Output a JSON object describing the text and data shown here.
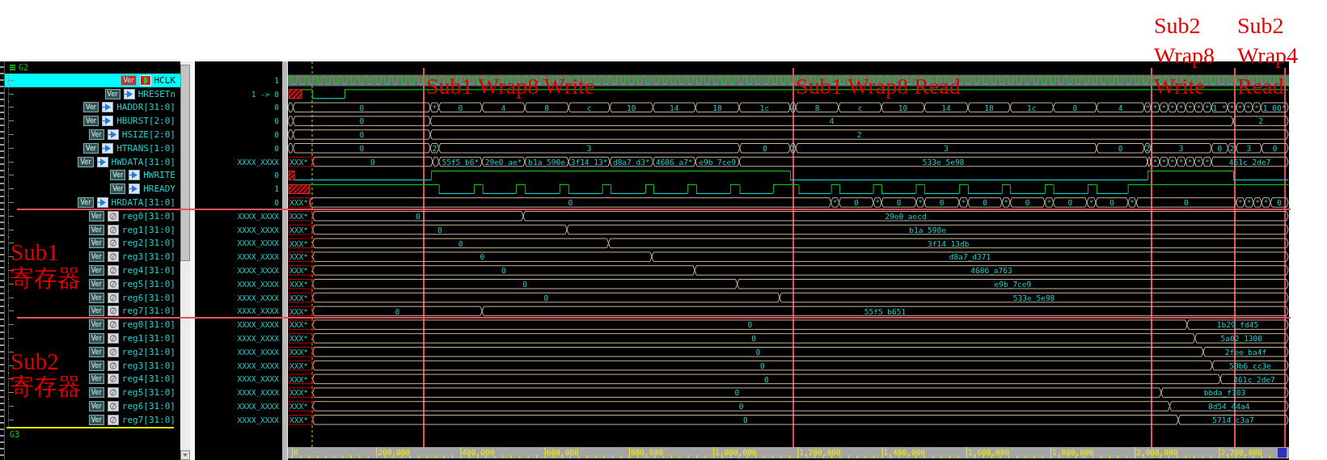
{
  "groups": [
    {
      "name": "G2",
      "expanded": true,
      "sections": [
        {
          "signals": [
            {
              "name": "HCLK",
              "badge": "Ver",
              "kind": "clock",
              "selected": true,
              "value": "1"
            },
            {
              "name": "HRESETn",
              "badge": "Ver",
              "kind": "bit",
              "selected": false,
              "value": "1 -> 0",
              "segments": [
                {
                  "kind": "unknown"
                },
                {
                  "kind": "high"
                },
                {
                  "kind": "low"
                },
                {
                  "kind": "high"
                }
              ]
            },
            {
              "name": "HADDR[31:0]",
              "badge": "Ver",
              "kind": "bus",
              "selected": false,
              "value": "0",
              "segments": [
                {
                  "kind": "blank"
                },
                {
                  "v": "0"
                },
                {
                  "v": "*"
                },
                {
                  "v": "0"
                },
                {
                  "v": "4"
                },
                {
                  "v": "8"
                },
                {
                  "v": "c"
                },
                {
                  "v": "10"
                },
                {
                  "v": "14"
                },
                {
                  "v": "18"
                },
                {
                  "v": "1c"
                },
                {
                  "v": "4"
                },
                {
                  "v": "8"
                },
                {
                  "v": "c"
                },
                {
                  "v": "10"
                },
                {
                  "v": "14"
                },
                {
                  "v": "18"
                },
                {
                  "v": "1c"
                },
                {
                  "v": "0"
                },
                {
                  "v": "4"
                },
                {
                  "v": "*"
                },
                {
                  "v": "*"
                },
                {
                  "v": "*"
                },
                {
                  "v": "*"
                },
                {
                  "v": "*"
                },
                {
                  "v": "*"
                },
                {
                  "v": "*"
                },
                {
                  "v": "*"
                },
                {
                  "v": "1_*"
                },
                {
                  "v": "*"
                },
                {
                  "v": "*"
                },
                {
                  "v": "*"
                },
                {
                  "v": "*"
                },
                {
                  "v": "1_00*"
                }
              ]
            },
            {
              "name": "HBURST[2:0]",
              "badge": "Ver",
              "kind": "bus",
              "selected": false,
              "value": "0",
              "segments": [
                {
                  "kind": "blank"
                },
                {
                  "v": "0"
                },
                {
                  "v": "4"
                },
                {
                  "v": "2"
                }
              ]
            },
            {
              "name": "HSIZE[2:0]",
              "badge": "Ver",
              "kind": "bus",
              "selected": false,
              "value": "0",
              "segments": [
                {
                  "kind": "blank"
                },
                {
                  "v": "0"
                },
                {
                  "v": "2"
                }
              ]
            },
            {
              "name": "HTRANS[1:0]",
              "badge": "Ver",
              "kind": "bus",
              "selected": false,
              "value": "0",
              "segments": [
                {
                  "kind": "blank"
                },
                {
                  "v": "0"
                },
                {
                  "v": "2"
                },
                {
                  "v": "3"
                },
                {
                  "v": "0"
                },
                {
                  "v": "2"
                },
                {
                  "v": "3"
                },
                {
                  "v": "0"
                },
                {
                  "v": "2"
                },
                {
                  "v": "3"
                },
                {
                  "v": "0"
                },
                {
                  "v": "2"
                },
                {
                  "v": "3"
                },
                {
                  "v": "0"
                }
              ]
            },
            {
              "name": "HWDATA[31:0]",
              "badge": "Ver",
              "kind": "bus",
              "selected": false,
              "value": "XXXX_XXXX",
              "unknown": {
                "label": "XXX*"
              },
              "segments": [
                {
                  "v": "0"
                },
                {
                  "kind": "blank"
                },
                {
                  "v": "55f5_b6*"
                },
                {
                  "v": "29e0_ae*"
                },
                {
                  "v": "b1a_590e"
                },
                {
                  "v": "3f14_13*"
                },
                {
                  "v": "d8a7_d3*"
                },
                {
                  "v": "4686_a7*"
                },
                {
                  "v": "e9b_7ce9"
                },
                {
                  "v": "533e_5e98"
                },
                {
                  "kind": "blank"
                },
                {
                  "v": "*"
                },
                {
                  "v": "*"
                },
                {
                  "v": "*"
                },
                {
                  "v": "*"
                },
                {
                  "v": "*"
                },
                {
                  "v": "*"
                },
                {
                  "v": "*"
                },
                {
                  "v": "461c_2de7"
                }
              ]
            },
            {
              "name": "HWRITE",
              "badge": "Ver",
              "kind": "bit",
              "selected": false,
              "value": "0",
              "segments": [
                {
                  "kind": "unknown"
                },
                {
                  "kind": "low"
                },
                {
                  "kind": "high"
                },
                {
                  "kind": "low"
                },
                {
                  "kind": "high"
                },
                {
                  "kind": "low"
                }
              ]
            },
            {
              "name": "HREADY",
              "badge": "Ver",
              "kind": "bit",
              "selected": false,
              "value": "1",
              "segments": [
                {
                  "kind": "unknown"
                },
                {
                  "kind": "high"
                },
                {
                  "kind": "low"
                },
                {
                  "kind": "high"
                },
                {
                  "kind": "low"
                },
                {
                  "kind": "high"
                },
                {
                  "kind": "low"
                },
                {
                  "kind": "high"
                },
                {
                  "kind": "low"
                },
                {
                  "kind": "high"
                },
                {
                  "kind": "low"
                },
                {
                  "kind": "high"
                },
                {
                  "kind": "low"
                },
                {
                  "kind": "high"
                },
                {
                  "kind": "low"
                },
                {
                  "kind": "high"
                },
                {
                  "kind": "low"
                },
                {
                  "kind": "high"
                },
                {
                  "kind": "low"
                },
                {
                  "kind": "high"
                },
                {
                  "kind": "low"
                },
                {
                  "kind": "high"
                },
                {
                  "kind": "low"
                },
                {
                  "kind": "high"
                },
                {
                  "kind": "low"
                },
                {
                  "kind": "high"
                },
                {
                  "kind": "low"
                },
                {
                  "kind": "high"
                },
                {
                  "kind": "low"
                },
                {
                  "kind": "high"
                },
                {
                  "kind": "low"
                },
                {
                  "kind": "high"
                },
                {
                  "kind": "low"
                },
                {
                  "kind": "high"
                }
              ]
            },
            {
              "name": "HRDATA[31:0]",
              "badge": "Ver",
              "kind": "bus",
              "selected": false,
              "value": "0",
              "unknown": {
                "label": "XXX*"
              },
              "segments": [
                {
                  "v": "0"
                },
                {
                  "v": "*"
                },
                {
                  "v": "0"
                },
                {
                  "v": "*"
                },
                {
                  "v": "0"
                },
                {
                  "v": "*"
                },
                {
                  "v": "0"
                },
                {
                  "v": "*"
                },
                {
                  "v": "0"
                },
                {
                  "v": "*"
                },
                {
                  "v": "0"
                },
                {
                  "v": "*"
                },
                {
                  "v": "0"
                },
                {
                  "v": "*"
                },
                {
                  "v": "0"
                },
                {
                  "v": "*"
                },
                {
                  "v": "0"
                },
                {
                  "v": "*"
                },
                {
                  "v": "*"
                },
                {
                  "v": "*"
                },
                {
                  "v": "*"
                },
                {
                  "v": "0"
                }
              ]
            }
          ]
        },
        {
          "label": "Sub1 寄存器",
          "signals": [
            {
              "name": "reg0[31:0]",
              "badge": "Ver",
              "kind": "register",
              "selected": false,
              "value": "XXXX_XXXX",
              "unknown": {
                "label": "XXX*"
              },
              "segments": [
                {
                  "v": "0"
                },
                {
                  "v": "29e0_aecd"
                }
              ]
            },
            {
              "name": "reg1[31:0]",
              "badge": "Ver",
              "kind": "register",
              "selected": false,
              "value": "XXXX_XXXX",
              "unknown": {
                "label": "XXX*"
              },
              "segments": [
                {
                  "v": "0"
                },
                {
                  "v": "b1a_590e"
                }
              ]
            },
            {
              "name": "reg2[31:0]",
              "badge": "Ver",
              "kind": "register",
              "selected": false,
              "value": "XXXX_XXXX",
              "unknown": {
                "label": "XXX*"
              },
              "segments": [
                {
                  "v": "0"
                },
                {
                  "v": "3f14_13db"
                }
              ]
            },
            {
              "name": "reg3[31:0]",
              "badge": "Ver",
              "kind": "register",
              "selected": false,
              "value": "XXXX_XXXX",
              "unknown": {
                "label": "XXX*"
              },
              "segments": [
                {
                  "v": "0"
                },
                {
                  "v": "d8a7_d371"
                }
              ]
            },
            {
              "name": "reg4[31:0]",
              "badge": "Ver",
              "kind": "register",
              "selected": false,
              "value": "XXXX_XXXX",
              "unknown": {
                "label": "XXX*"
              },
              "segments": [
                {
                  "v": "0"
                },
                {
                  "v": "4686_a763"
                }
              ]
            },
            {
              "name": "reg5[31:0]",
              "badge": "Ver",
              "kind": "register",
              "selected": false,
              "value": "XXXX_XXXX",
              "unknown": {
                "label": "XXX*"
              },
              "segments": [
                {
                  "v": "0"
                },
                {
                  "v": "e9b_7ce9"
                }
              ]
            },
            {
              "name": "reg6[31:0]",
              "badge": "Ver",
              "kind": "register",
              "selected": false,
              "value": "XXXX_XXXX",
              "unknown": {
                "label": "XXX*"
              },
              "segments": [
                {
                  "v": "0"
                },
                {
                  "v": "533e_5e98"
                }
              ]
            },
            {
              "name": "reg7[31:0]",
              "badge": "Ver",
              "kind": "register",
              "selected": false,
              "value": "XXXX_XXXX",
              "unknown": {
                "label": "XXX*"
              },
              "segments": [
                {
                  "v": "0"
                },
                {
                  "v": "55f5_b651"
                }
              ]
            }
          ]
        },
        {
          "label": "Sub2 寄存器",
          "signals": [
            {
              "name": "reg0[31:0]",
              "badge": "Ver",
              "kind": "register",
              "selected": false,
              "value": "XXXX_XXXX",
              "unknown": {
                "label": "XXX*"
              },
              "segments": [
                {
                  "v": "0"
                },
                {
                  "v": "1b29_fd45"
                }
              ]
            },
            {
              "name": "reg1[31:0]",
              "badge": "Ver",
              "kind": "register",
              "selected": false,
              "value": "XXXX_XXXX",
              "unknown": {
                "label": "XXX*"
              },
              "segments": [
                {
                  "v": "0"
                },
                {
                  "v": "5a02_1300"
                }
              ]
            },
            {
              "name": "reg2[31:0]",
              "badge": "Ver",
              "kind": "register",
              "selected": false,
              "value": "XXXX_XXXX",
              "unknown": {
                "label": "XXX*"
              },
              "segments": [
                {
                  "v": "0"
                },
                {
                  "v": "2fee_ba4f"
                }
              ]
            },
            {
              "name": "reg3[31:0]",
              "badge": "Ver",
              "kind": "register",
              "selected": false,
              "value": "XXXX_XXXX",
              "unknown": {
                "label": "XXX*"
              },
              "segments": [
                {
                  "v": "0"
                },
                {
                  "v": "50b6_cc3e"
                }
              ]
            },
            {
              "name": "reg4[31:0]",
              "badge": "Ver",
              "kind": "register",
              "selected": false,
              "value": "XXXX_XXXX",
              "unknown": {
                "label": "XXX*"
              },
              "segments": [
                {
                  "v": "0"
                },
                {
                  "v": "461c_2de7"
                }
              ]
            },
            {
              "name": "reg5[31:0]",
              "badge": "Ver",
              "kind": "register",
              "selected": false,
              "value": "XXXX_XXXX",
              "unknown": {
                "label": "XXX*"
              },
              "segments": [
                {
                  "v": "0"
                },
                {
                  "v": "bbda_f103"
                }
              ]
            },
            {
              "name": "reg6[31:0]",
              "badge": "Ver",
              "kind": "register",
              "selected": false,
              "value": "XXXX_XXXX",
              "unknown": {
                "label": "XXX*"
              },
              "segments": [
                {
                  "v": "0"
                },
                {
                  "v": "8d54_44a4"
                }
              ]
            },
            {
              "name": "reg7[31:0]",
              "badge": "Ver",
              "kind": "register",
              "selected": false,
              "value": "XXXX_XXXX",
              "unknown": {
                "label": "XXX*"
              },
              "segments": [
                {
                  "v": "0"
                },
                {
                  "v": "5714_c3a7"
                }
              ]
            }
          ]
        }
      ]
    },
    {
      "name": "G3",
      "expanded": false
    }
  ],
  "markers": [
    {
      "label": "Sub1 Wrap8 Write"
    },
    {
      "label": "Sub1 Wrap8 Read"
    },
    {
      "label": "Sub2 Wrap8 Write"
    },
    {
      "label": "Sub2 Wrap4 Read"
    }
  ],
  "time_axis": {
    "ticks": [
      "0",
      "200,000",
      "400,000",
      "600,000",
      "800,000",
      "1,000,000",
      "1,200,000",
      "1,400,000",
      "1,600,000",
      "1,800,000",
      "2,000,000",
      "2,200,000"
    ]
  }
}
